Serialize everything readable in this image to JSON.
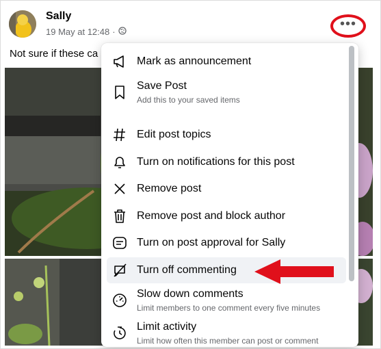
{
  "post": {
    "author": "Sally",
    "timestamp": "19 May at 12:48",
    "separator": "·",
    "audience_icon": "globe-icon",
    "text": "Not sure if these ca",
    "more_icon": "more-horizontal-icon",
    "more_dots": "•••"
  },
  "menu": {
    "items": [
      {
        "label": "Mark as announcement",
        "icon": "megaphone-icon"
      },
      {
        "label": "Save Post",
        "sublabel": "Add this to your saved items",
        "icon": "bookmark-icon"
      },
      {
        "label": "Edit post topics",
        "icon": "hashtag-icon"
      },
      {
        "label": "Turn on notifications for this post",
        "icon": "bell-icon"
      },
      {
        "label": "Remove post",
        "icon": "close-icon"
      },
      {
        "label": "Remove post and block author",
        "icon": "trash-icon"
      },
      {
        "label": "Turn on post approval for Sally",
        "icon": "post-approval-icon"
      },
      {
        "label": "Turn off commenting",
        "icon": "comment-off-icon"
      },
      {
        "label": "Slow down comments",
        "sublabel": "Limit members to one comment every five minutes",
        "icon": "speedometer-icon"
      },
      {
        "label": "Limit activity",
        "sublabel": "Limit how often this member can post or comment",
        "icon": "timer-icon"
      }
    ]
  },
  "annotations": {
    "circle_color": "#e0101b",
    "arrow_color": "#e0101b"
  }
}
